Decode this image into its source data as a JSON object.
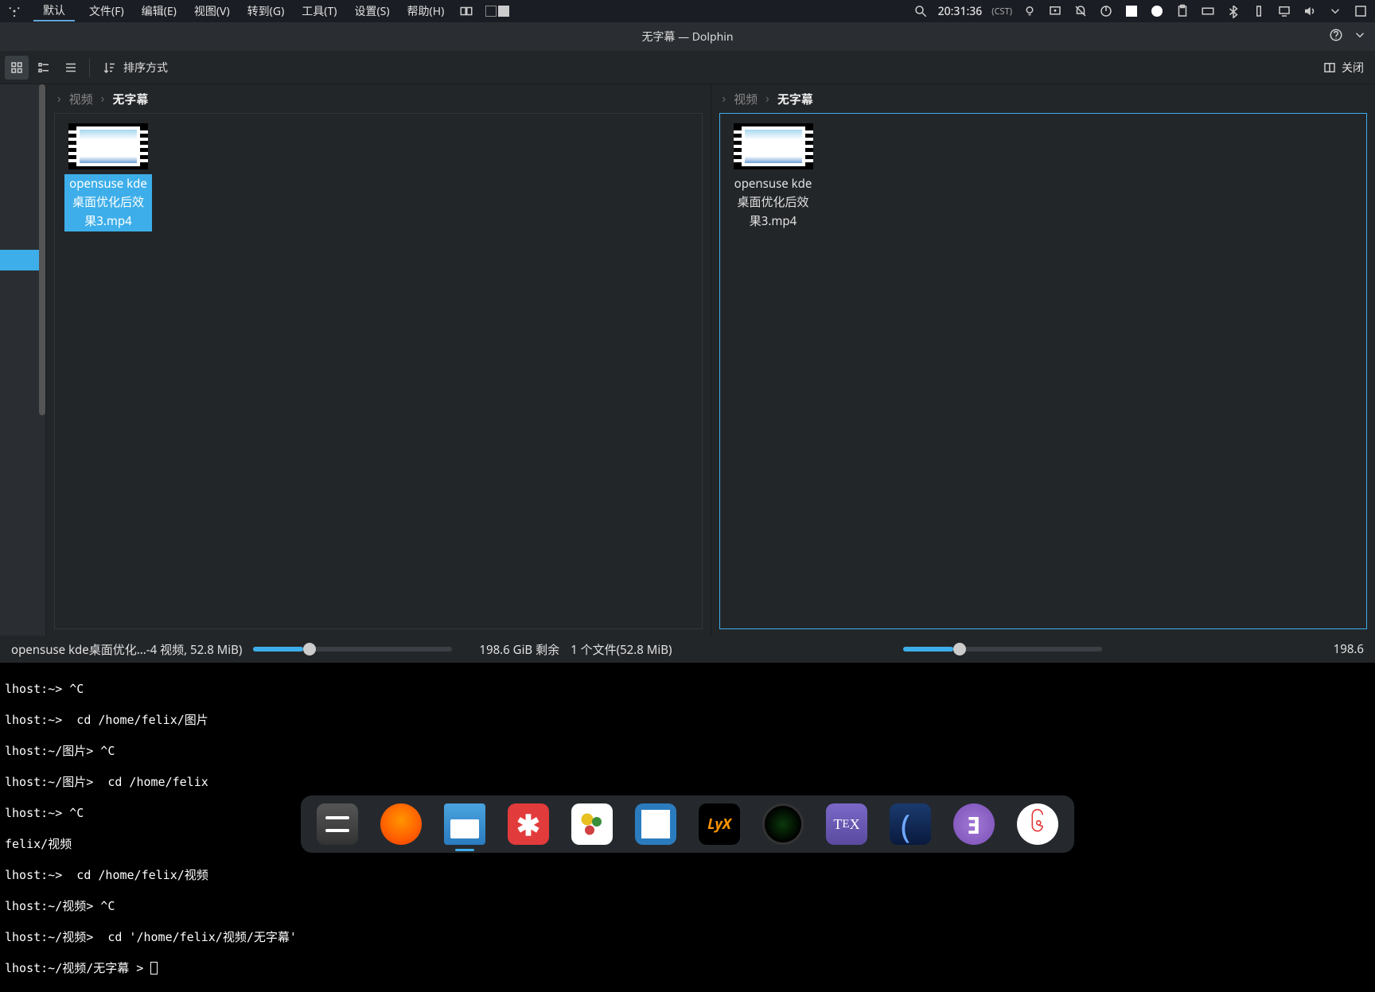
{
  "panel": {
    "activity": "默认",
    "menus": [
      "文件(F)",
      "编辑(E)",
      "视图(V)",
      "转到(G)",
      "工具(T)",
      "设置(S)",
      "帮助(H)"
    ],
    "clock": "20:31:36",
    "tz": "(CST)"
  },
  "dolphin": {
    "title": "无字幕 — Dolphin",
    "sort_label": "排序方式",
    "close_label": "关闭",
    "breadcrumb": {
      "parent": "视频",
      "current": "无字幕"
    },
    "file_name": "opensuse kde桌面优化后效果3.mp4",
    "status_left": "opensuse kde桌面优化...-4 视频, 52.8 MiB)",
    "status_mid": "198.6 GiB 剩余",
    "status_right_count": "1 个文件(52.8 MiB)",
    "status_right2": "198.6"
  },
  "terminal": {
    "lines": [
      "lhost:~> ^C",
      "lhost:~>  cd /home/felix/图片",
      "lhost:~/图片> ^C",
      "lhost:~/图片>  cd /home/felix",
      "lhost:~> ^C",
      "felix/视频",
      "lhost:~>  cd /home/felix/视频",
      "lhost:~/视频> ^C",
      "lhost:~/视频>  cd '/home/felix/视频/无字幕'",
      "lhost:~/视频/无字幕 > "
    ]
  },
  "dock": {
    "items": [
      "settings",
      "firefox",
      "files",
      "mathematica",
      "jmol",
      "document",
      "lyx",
      "lens",
      "tex",
      "kdenlive",
      "emacs",
      "netease-music"
    ]
  }
}
